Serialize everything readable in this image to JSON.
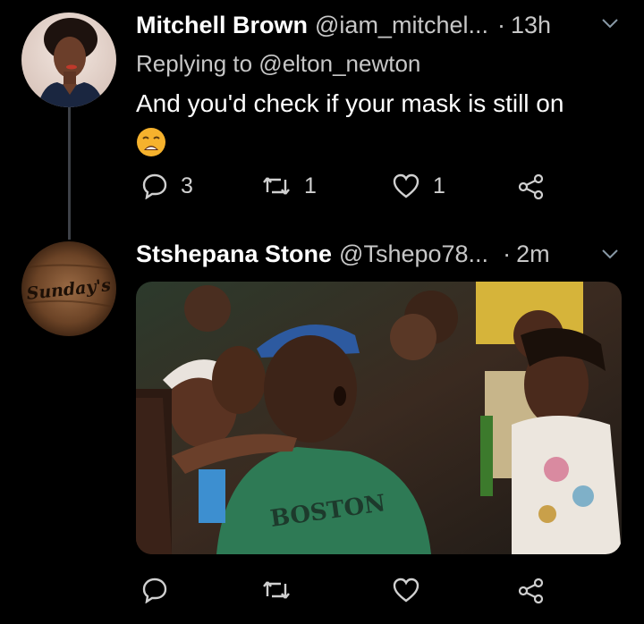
{
  "tweets": [
    {
      "name": "Mitchell Brown",
      "handle": "@iam_mitchel...",
      "separator": "·",
      "time": "13h",
      "replying_to": "Replying to @elton_newton",
      "text": "And you'd check if your mask is still on",
      "emoji": "weary-face-emoji",
      "reply_count": "3",
      "retweet_count": "1",
      "like_count": "1"
    },
    {
      "name": "Stshepana Stone",
      "handle": "@Tshepo78...",
      "separator": "·",
      "time": "2m",
      "avatar_text": "Sunday's",
      "media_shirt_text": "BOSTON",
      "reply_count": "",
      "retweet_count": "",
      "like_count": ""
    }
  ],
  "icons": {
    "reply": "reply-icon",
    "retweet": "retweet-icon",
    "like": "heart-icon",
    "share": "share-icon",
    "menu": "chevron-down-icon"
  },
  "colors": {
    "background": "#000000",
    "name": "#ffffff",
    "secondary": "#c7c7c7",
    "thread_line": "#3d4148"
  }
}
